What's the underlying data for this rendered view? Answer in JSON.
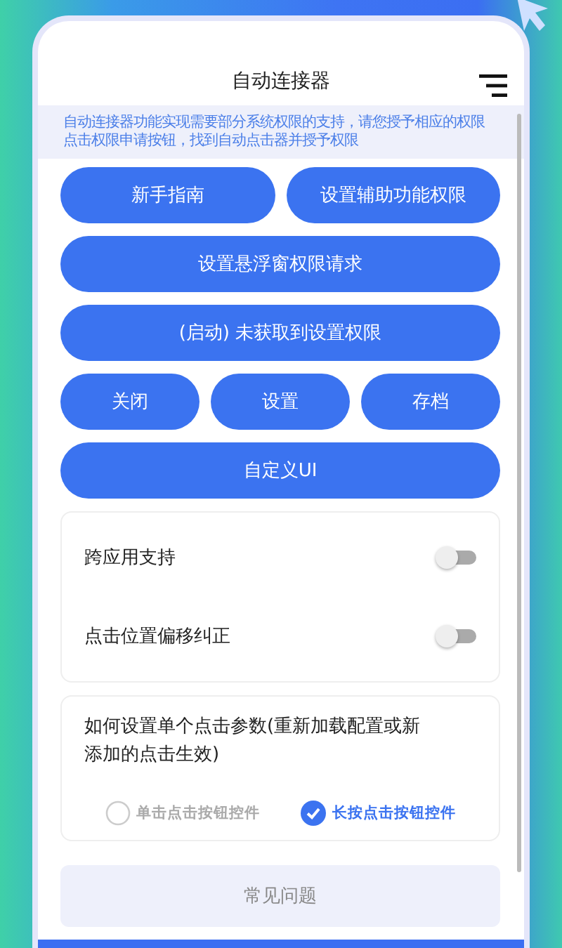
{
  "title": "自动连接器",
  "notice": [
    "自动连接器功能实现需要部分系统权限的支持，请您授予相应的权限",
    "点击权限申请按钮，找到自动点击器并授予权限"
  ],
  "button_rows": [
    [
      "新手指南",
      "设置辅助功能权限"
    ],
    [
      "设置悬浮窗权限请求"
    ],
    [
      "(启动) 未获取到设置权限"
    ],
    [
      "关闭",
      "设置",
      "存档"
    ],
    [
      "自定义UI"
    ]
  ],
  "toggles": [
    {
      "label": "跨应用支持",
      "on": false
    },
    {
      "label": "点击位置偏移纠正",
      "on": false
    }
  ],
  "click_params": {
    "question": "如何设置单个点击参数(重新加载配置或新添加的点击生效)",
    "options": [
      {
        "label": "单击点击按钮控件",
        "selected": false
      },
      {
        "label": "长按点击按钮控件",
        "selected": true
      }
    ]
  },
  "faq_button": "常见问题"
}
